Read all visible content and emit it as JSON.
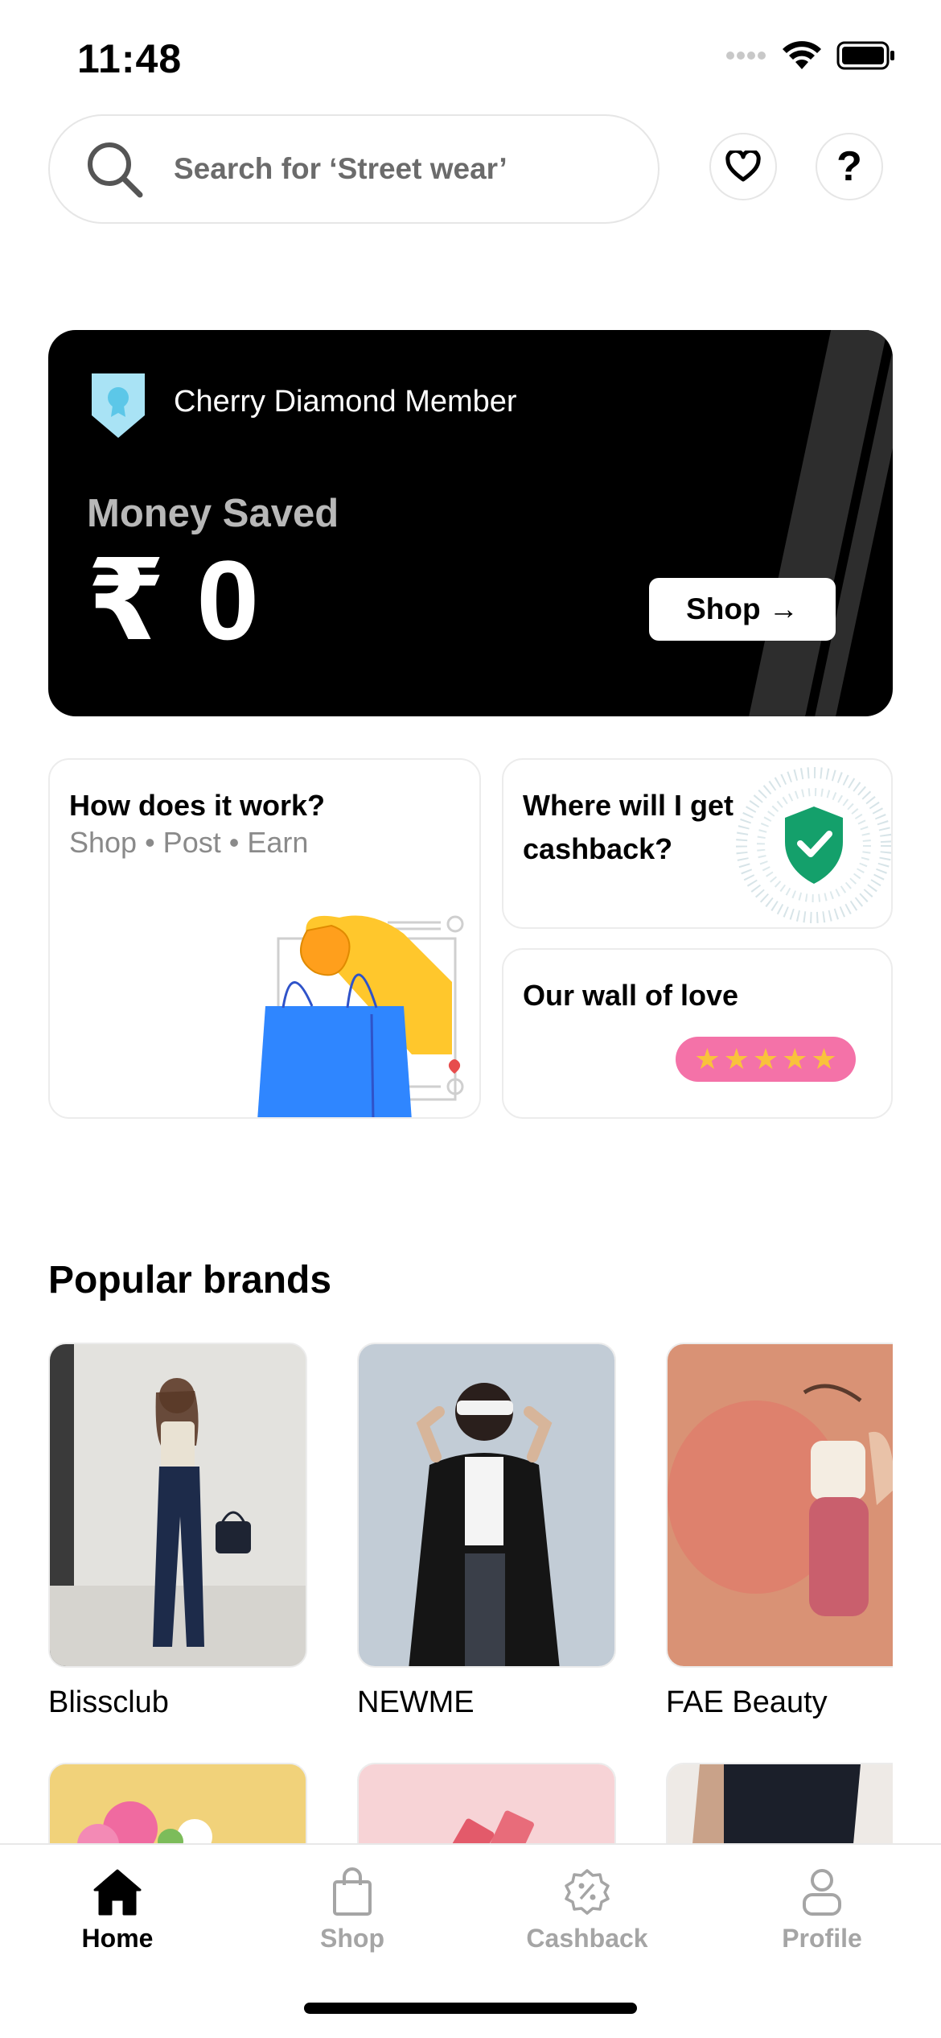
{
  "status_bar": {
    "time": "11:48"
  },
  "search": {
    "placeholder": "Search for ‘Street wear’"
  },
  "member_card": {
    "tier": "Cherry Diamond Member",
    "saved_label": "Money Saved",
    "saved_amount": "₹ 0",
    "shop_label": "Shop →"
  },
  "cards": {
    "how": {
      "title": "How does it work?",
      "subtitle": "Shop • Post • Earn"
    },
    "cashback": {
      "title": "Where will I get cashback?"
    },
    "love": {
      "title": "Our wall of love",
      "rating": 5
    }
  },
  "popular_brands": {
    "title": "Popular brands",
    "brands": [
      {
        "name": "Blissclub"
      },
      {
        "name": "NEWME"
      },
      {
        "name": "FAE Beauty"
      }
    ]
  },
  "tab_bar": {
    "tabs": [
      {
        "label": "Home",
        "icon": "home-icon",
        "active": true
      },
      {
        "label": "Shop",
        "icon": "shopping-bag-icon",
        "active": false
      },
      {
        "label": "Cashback",
        "icon": "cashback-badge-icon",
        "active": false
      },
      {
        "label": "Profile",
        "icon": "profile-icon",
        "active": false
      }
    ]
  },
  "colors": {
    "accent_pink": "#f472a8",
    "star_yellow": "#f9c23c",
    "shield_green": "#14a06b",
    "badge_blue": "#a9e3f5"
  }
}
